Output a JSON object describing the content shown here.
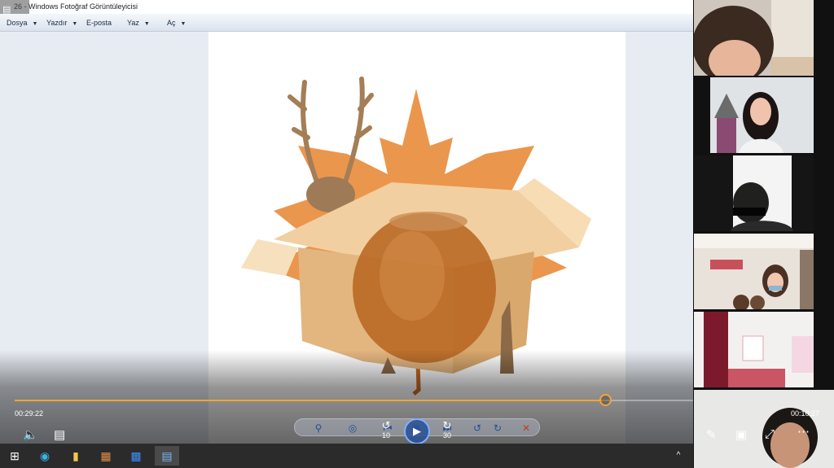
{
  "window": {
    "title": "26 - Windows Fotoğraf Görüntüleyicisi",
    "icon": "photo-viewer-icon"
  },
  "menu": [
    {
      "label": "Dosya"
    },
    {
      "label": "Yazdır"
    },
    {
      "label": "E-posta"
    },
    {
      "label": "Yaz"
    },
    {
      "label": "Aç"
    }
  ],
  "video": {
    "elapsed": "00:29:22",
    "remaining": "00:10:27",
    "progress_pct": 72.5,
    "skip_back_label": "10",
    "skip_forward_label": "30",
    "accent_color": "#f0a53a"
  },
  "photo_viewer_controls": [
    {
      "name": "zoom",
      "icon": "zoom-icon"
    },
    {
      "name": "actual-size",
      "icon": "fit-icon"
    },
    {
      "name": "previous",
      "icon": "previous-icon"
    },
    {
      "name": "slideshow",
      "icon": "slideshow-icon"
    },
    {
      "name": "next",
      "icon": "next-icon"
    },
    {
      "name": "rotate-left",
      "icon": "rotate-left-icon"
    },
    {
      "name": "rotate-right",
      "icon": "rotate-right-icon"
    },
    {
      "name": "delete",
      "icon": "delete-icon"
    }
  ],
  "participants": [
    {
      "name": "participant-1"
    },
    {
      "name": "participant-2"
    },
    {
      "name": "participant-3"
    },
    {
      "name": "participant-4"
    },
    {
      "name": "participant-5"
    },
    {
      "name": "participant-6"
    }
  ],
  "taskbar": [
    {
      "icon": "windows-start-icon"
    },
    {
      "icon": "edge-browser-icon"
    },
    {
      "icon": "file-explorer-icon"
    },
    {
      "icon": "paint-icon"
    },
    {
      "icon": "zoom-app-icon"
    },
    {
      "icon": "photo-viewer-icon"
    }
  ]
}
